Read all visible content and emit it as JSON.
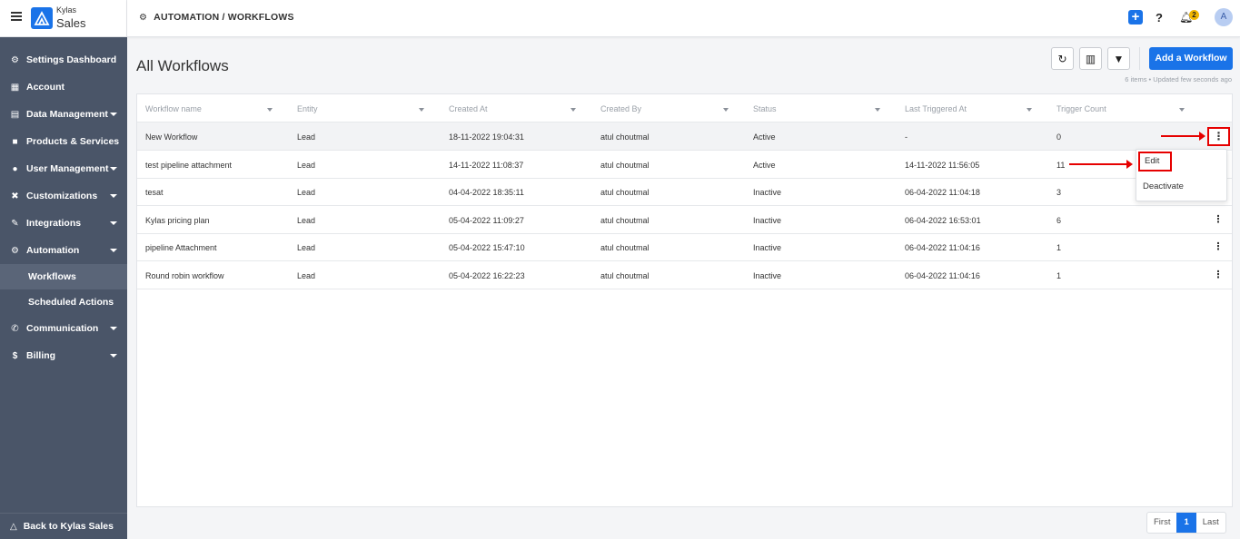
{
  "brand": {
    "top": "Kylas",
    "bottom": "Sales"
  },
  "sidebar": {
    "items": [
      {
        "label": "Settings Dashboard",
        "icon": "gear-icon"
      },
      {
        "label": "Account",
        "icon": "building-icon"
      },
      {
        "label": "Data Management",
        "icon": "table-icon"
      },
      {
        "label": "Products & Services",
        "icon": "box-icon"
      },
      {
        "label": "User Management",
        "icon": "users-icon"
      },
      {
        "label": "Customizations",
        "icon": "tools-icon"
      },
      {
        "label": "Integrations",
        "icon": "plug-icon"
      },
      {
        "label": "Automation",
        "icon": "cogs-icon"
      },
      {
        "label": "Communication",
        "icon": "phone-icon"
      },
      {
        "label": "Billing",
        "icon": "dollar-icon"
      }
    ],
    "sub_items": [
      "Workflows",
      "Scheduled Actions"
    ],
    "back": "Back to Kylas Sales"
  },
  "header": {
    "breadcrumb": "AUTOMATION / WORKFLOWS",
    "notification_count": "2",
    "avatar": "A"
  },
  "main": {
    "title": "All Workflows",
    "add_button": "Add a Workflow",
    "meta": "6 items • Updated few seconds ago"
  },
  "table": {
    "columns": [
      "Workflow name",
      "Entity",
      "Created At",
      "Created By",
      "Status",
      "Last Triggered At",
      "Trigger Count"
    ],
    "rows": [
      [
        "New Workflow",
        "Lead",
        "18-11-2022 19:04:31",
        "atul choutmal",
        "Active",
        "-",
        "0"
      ],
      [
        "test pipeline attachment",
        "Lead",
        "14-11-2022 11:08:37",
        "atul choutmal",
        "Active",
        "14-11-2022 11:56:05",
        "11"
      ],
      [
        "tesat",
        "Lead",
        "04-04-2022 18:35:11",
        "atul choutmal",
        "Inactive",
        "06-04-2022 11:04:18",
        "3"
      ],
      [
        "Kylas pricing plan",
        "Lead",
        "05-04-2022 11:09:27",
        "atul choutmal",
        "Inactive",
        "06-04-2022 16:53:01",
        "6"
      ],
      [
        "pipeline Attachment",
        "Lead",
        "05-04-2022 15:47:10",
        "atul choutmal",
        "Inactive",
        "06-04-2022 11:04:16",
        "1"
      ],
      [
        "Round robin workflow",
        "Lead",
        "05-04-2022 16:22:23",
        "atul choutmal",
        "Inactive",
        "06-04-2022 11:04:16",
        "1"
      ]
    ]
  },
  "dropdown": {
    "edit": "Edit",
    "deactivate": "Deactivate"
  },
  "pagination": {
    "first": "First",
    "current": "1",
    "last": "Last"
  },
  "colors": {
    "sidebar": "#4a5568",
    "accent": "#1a73e8",
    "highlight": "#e60000"
  }
}
